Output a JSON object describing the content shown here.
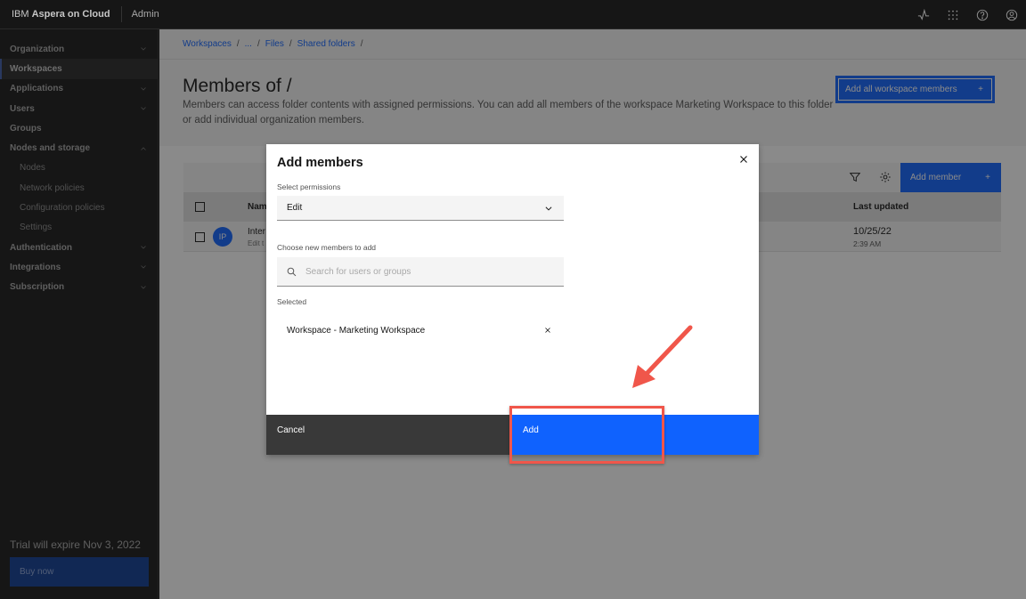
{
  "header": {
    "brand_prefix": "IBM",
    "brand_name": "Aspera on Cloud",
    "context": "Admin",
    "icons": [
      "activity-icon",
      "app-switcher-icon",
      "help-icon",
      "user-avatar-icon"
    ]
  },
  "sidebar": {
    "items": [
      {
        "label": "Organization",
        "expandable": true,
        "expanded": false
      },
      {
        "label": "Workspaces",
        "active": true
      },
      {
        "label": "Applications",
        "expandable": true,
        "expanded": false
      },
      {
        "label": "Users",
        "expandable": true,
        "expanded": false
      },
      {
        "label": "Groups"
      },
      {
        "label": "Nodes and storage",
        "expandable": true,
        "expanded": true
      },
      {
        "label": "Nodes",
        "sub": true
      },
      {
        "label": "Network policies",
        "sub": true
      },
      {
        "label": "Configuration policies",
        "sub": true
      },
      {
        "label": "Settings",
        "sub": true
      },
      {
        "label": "Authentication",
        "expandable": true,
        "expanded": false
      },
      {
        "label": "Integrations",
        "expandable": true,
        "expanded": false
      },
      {
        "label": "Subscription",
        "expandable": true,
        "expanded": false
      }
    ],
    "trial_text": "Trial will expire Nov 3, 2022",
    "buy_label": "Buy now"
  },
  "breadcrumb": [
    "Workspaces",
    "...",
    "Files",
    "Shared folders"
  ],
  "page": {
    "title": "Members of /",
    "description": "Members can access folder contents with assigned permissions. You can add all members of the workspace Marketing Workspace to this folder or add individual organization members.",
    "add_all_label": "Add all workspace members"
  },
  "table": {
    "add_member_label": "Add member",
    "columns": [
      "Name",
      "Last updated"
    ],
    "rows": [
      {
        "initials": "IP",
        "name": "Inter",
        "subtitle": "Edit t",
        "date": "10/25/22",
        "time": "2:39 AM"
      }
    ]
  },
  "modal": {
    "title": "Add members",
    "permissions_label": "Select permissions",
    "permissions_value": "Edit",
    "members_label": "Choose new members to add",
    "search_placeholder": "Search for users or groups",
    "selected_label": "Selected",
    "selected_items": [
      "Workspace - Marketing Workspace"
    ],
    "cancel_label": "Cancel",
    "add_label": "Add"
  },
  "colors": {
    "primary": "#0f62fe",
    "annotation": "#f0564a",
    "sidebar_bg": "#161616"
  }
}
